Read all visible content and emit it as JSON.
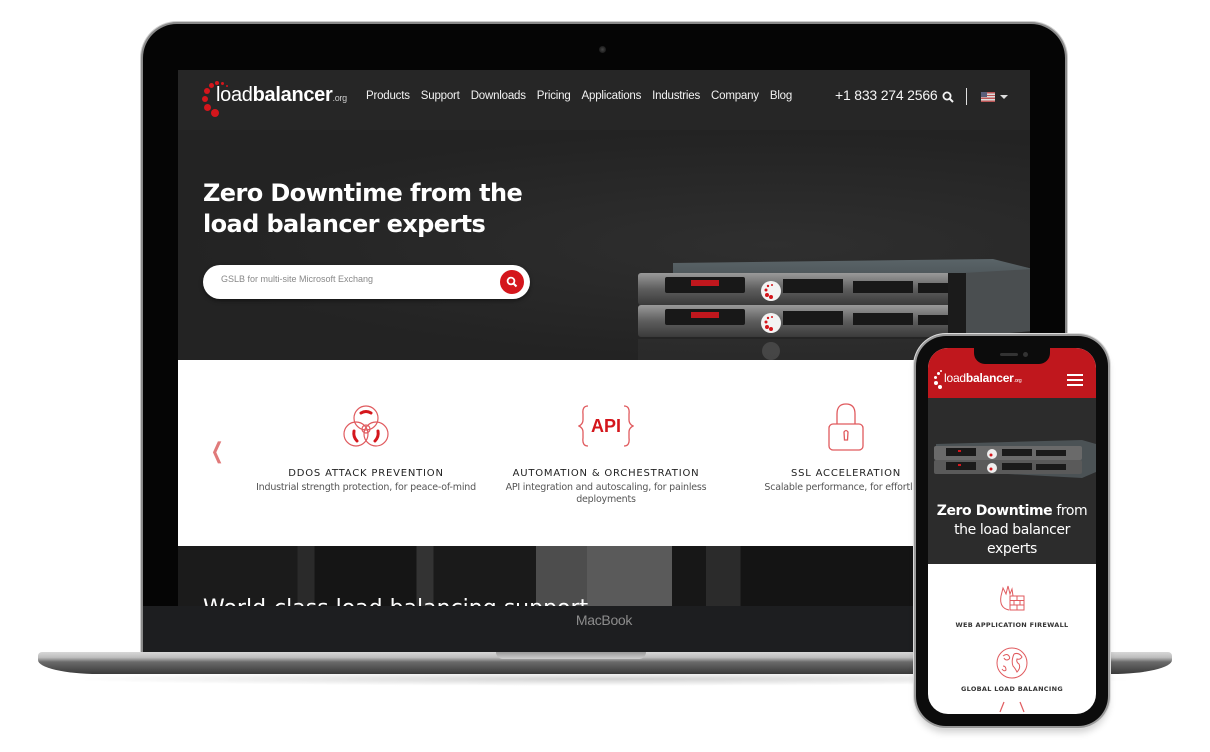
{
  "laptop": {
    "brand_label": "MacBook"
  },
  "site": {
    "logo": {
      "name_light": "load",
      "name_bold": "balancer",
      "suffix": ".org"
    },
    "nav": [
      "Products",
      "Support",
      "Downloads",
      "Pricing",
      "Applications",
      "Industries",
      "Company",
      "Blog"
    ],
    "phone": "+1 833 274 2566",
    "icons": {
      "search": "search-icon",
      "flag": "us-flag-icon",
      "caret": "caret-down-icon"
    },
    "hero": {
      "title_bold": "Zero Downtime",
      "title_rest": " from the load balancer experts",
      "search_value": "GSLB for multi-site Microsoft Exchang",
      "search_button_icon": "search-icon"
    },
    "features": [
      {
        "icon": "biohazard-icon",
        "title": "DDOS ATTACK PREVENTION",
        "desc": "Industrial strength protection, for peace-of-mind"
      },
      {
        "icon": "api-icon",
        "title": "AUTOMATION & ORCHESTRATION",
        "desc": "API integration and autoscaling, for painless deployments"
      },
      {
        "icon": "padlock-icon",
        "title": "SSL ACCELERATION",
        "desc": "Scalable performance, for effortless"
      }
    ],
    "carousel_prev_icon": "chevron-left-icon",
    "next_section_text": "World-class load balancing support"
  },
  "mobile": {
    "logo": {
      "name_light": "load",
      "name_bold": "balancer",
      "suffix": ".org"
    },
    "menu_icon": "hamburger-menu-icon",
    "hero": {
      "title_bold": "Zero Downtime",
      "title_rest": " from the load balancer experts"
    },
    "features": [
      {
        "icon": "firewall-icon",
        "title": "WEB APPLICATION FIREWALL"
      },
      {
        "icon": "globe-icon",
        "title": "GLOBAL LOAD BALANCING"
      }
    ]
  },
  "colors": {
    "brand_red": "#d4161c",
    "mobile_header_red": "#c0171d",
    "hero_bg": "#262626",
    "icon_stroke": "#e05a5e"
  }
}
